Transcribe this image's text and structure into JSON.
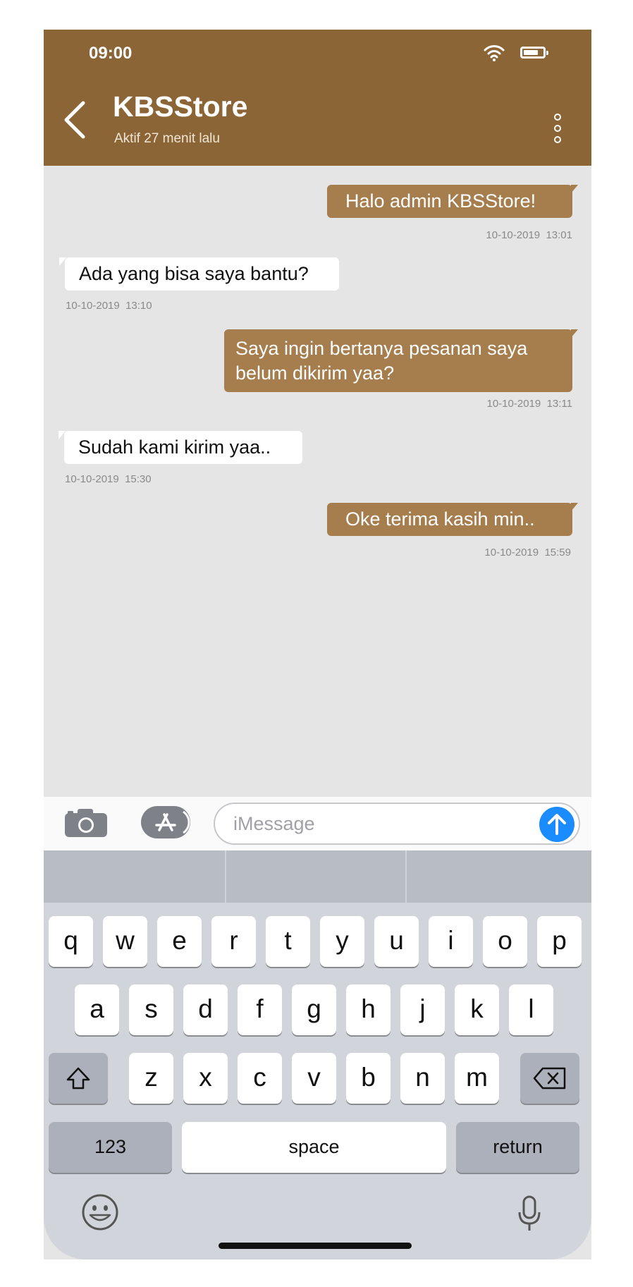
{
  "status": {
    "time": "09:00"
  },
  "header": {
    "contact_name": "KBSStore",
    "last_seen": "Aktif 27 menit lalu"
  },
  "messages": [
    {
      "direction": "out",
      "text": "Halo admin KBSStore!",
      "timestamp": "10-10-2019  13:01"
    },
    {
      "direction": "in",
      "text": "Ada yang bisa saya bantu?",
      "timestamp": "10-10-2019  13:10"
    },
    {
      "direction": "out",
      "text": "Saya ingin bertanya pesanan saya belum dikirim yaa?",
      "timestamp": "10-10-2019  13:11"
    },
    {
      "direction": "in",
      "text": "Sudah kami kirim yaa..",
      "timestamp": "10-10-2019  15:30"
    },
    {
      "direction": "out",
      "text": "Oke terima kasih min..",
      "timestamp": "10-10-2019  15:59"
    }
  ],
  "composer": {
    "placeholder": "iMessage"
  },
  "keyboard": {
    "row1": [
      "q",
      "w",
      "e",
      "r",
      "t",
      "y",
      "u",
      "i",
      "o",
      "p"
    ],
    "row2": [
      "a",
      "s",
      "d",
      "f",
      "g",
      "h",
      "j",
      "k",
      "l"
    ],
    "row3": [
      "z",
      "x",
      "c",
      "v",
      "b",
      "n",
      "m"
    ],
    "numbers_label": "123",
    "space_label": "space",
    "return_label": "return"
  },
  "icons": {
    "back": "chevron-left-icon",
    "menu": "vertical-ellipsis-icon",
    "camera": "camera-icon",
    "appstore": "app-store-icon",
    "send": "arrow-up-icon",
    "shift": "shift-icon",
    "delete": "backspace-icon",
    "emoji": "emoji-icon",
    "mic": "microphone-icon"
  },
  "colors": {
    "header": "#8b6535",
    "outgoing_bubble": "#a67e4e",
    "incoming_bubble": "#ffffff",
    "chat_bg": "#e5e5e5",
    "send": "#1a8cff"
  }
}
